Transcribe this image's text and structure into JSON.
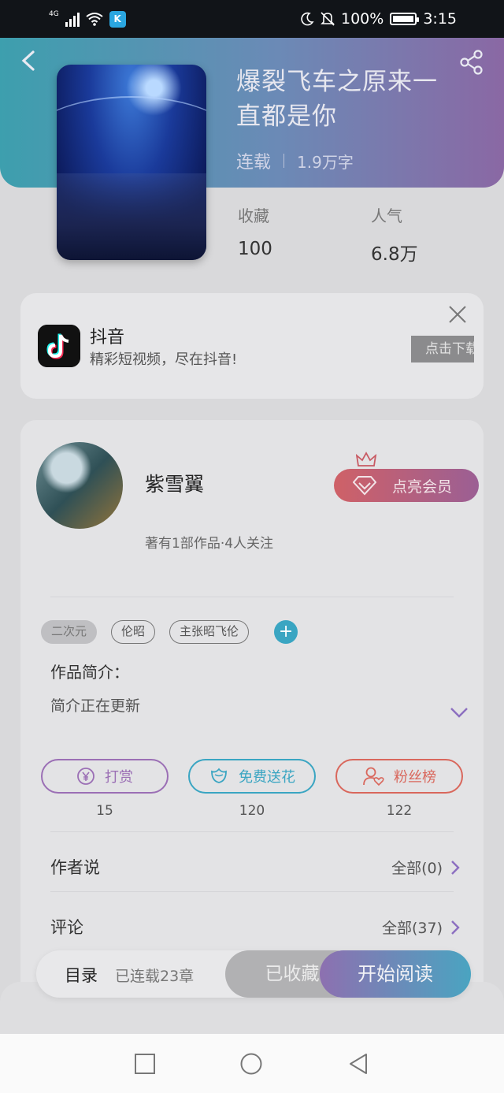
{
  "status_bar": {
    "network": "4G",
    "battery": "100%",
    "time": "3:15",
    "icons": [
      "signal-icon",
      "wifi-icon",
      "app-k-icon",
      "moon-icon",
      "mute-icon",
      "battery-icon"
    ]
  },
  "book": {
    "title": "爆裂飞车之原来一直都是你",
    "status": "连载",
    "word_count": "1.9万字",
    "stats": [
      {
        "label": "收藏",
        "value": "100"
      },
      {
        "label": "人气",
        "value": "6.8万"
      }
    ]
  },
  "ad": {
    "app_name": "抖音",
    "description": "精彩短视频，尽在抖音!",
    "button_label": "点击下载"
  },
  "author": {
    "name": "紫雪翼",
    "meta": "著有1部作品·4人关注",
    "vip_button": "点亮会员"
  },
  "tags": [
    "二次元",
    "伦昭",
    "主张昭飞伦"
  ],
  "intro": {
    "title": "作品简介：",
    "text": "简介正在更新"
  },
  "actions": [
    {
      "label": "打赏",
      "count": "15",
      "color": "#9b6fb5"
    },
    {
      "label": "免费送花",
      "count": "120",
      "color": "#3aa5c2"
    },
    {
      "label": "粉丝榜",
      "count": "122",
      "color": "#d9675c"
    }
  ],
  "rows": [
    {
      "title": "作者说",
      "link": "全部(0)"
    },
    {
      "title": "评论",
      "link": "全部(37)"
    }
  ],
  "bottom_bar": {
    "toc": "目录",
    "toc_sub": "已连载23章",
    "collected": "已收藏",
    "start": "开始阅读"
  },
  "colors": {
    "header_start": "#3d9fae",
    "header_end": "#8a68a4",
    "vip_start": "#cf6167",
    "vip_end": "#9b5f94",
    "accent_blue": "#3aa5c2"
  }
}
